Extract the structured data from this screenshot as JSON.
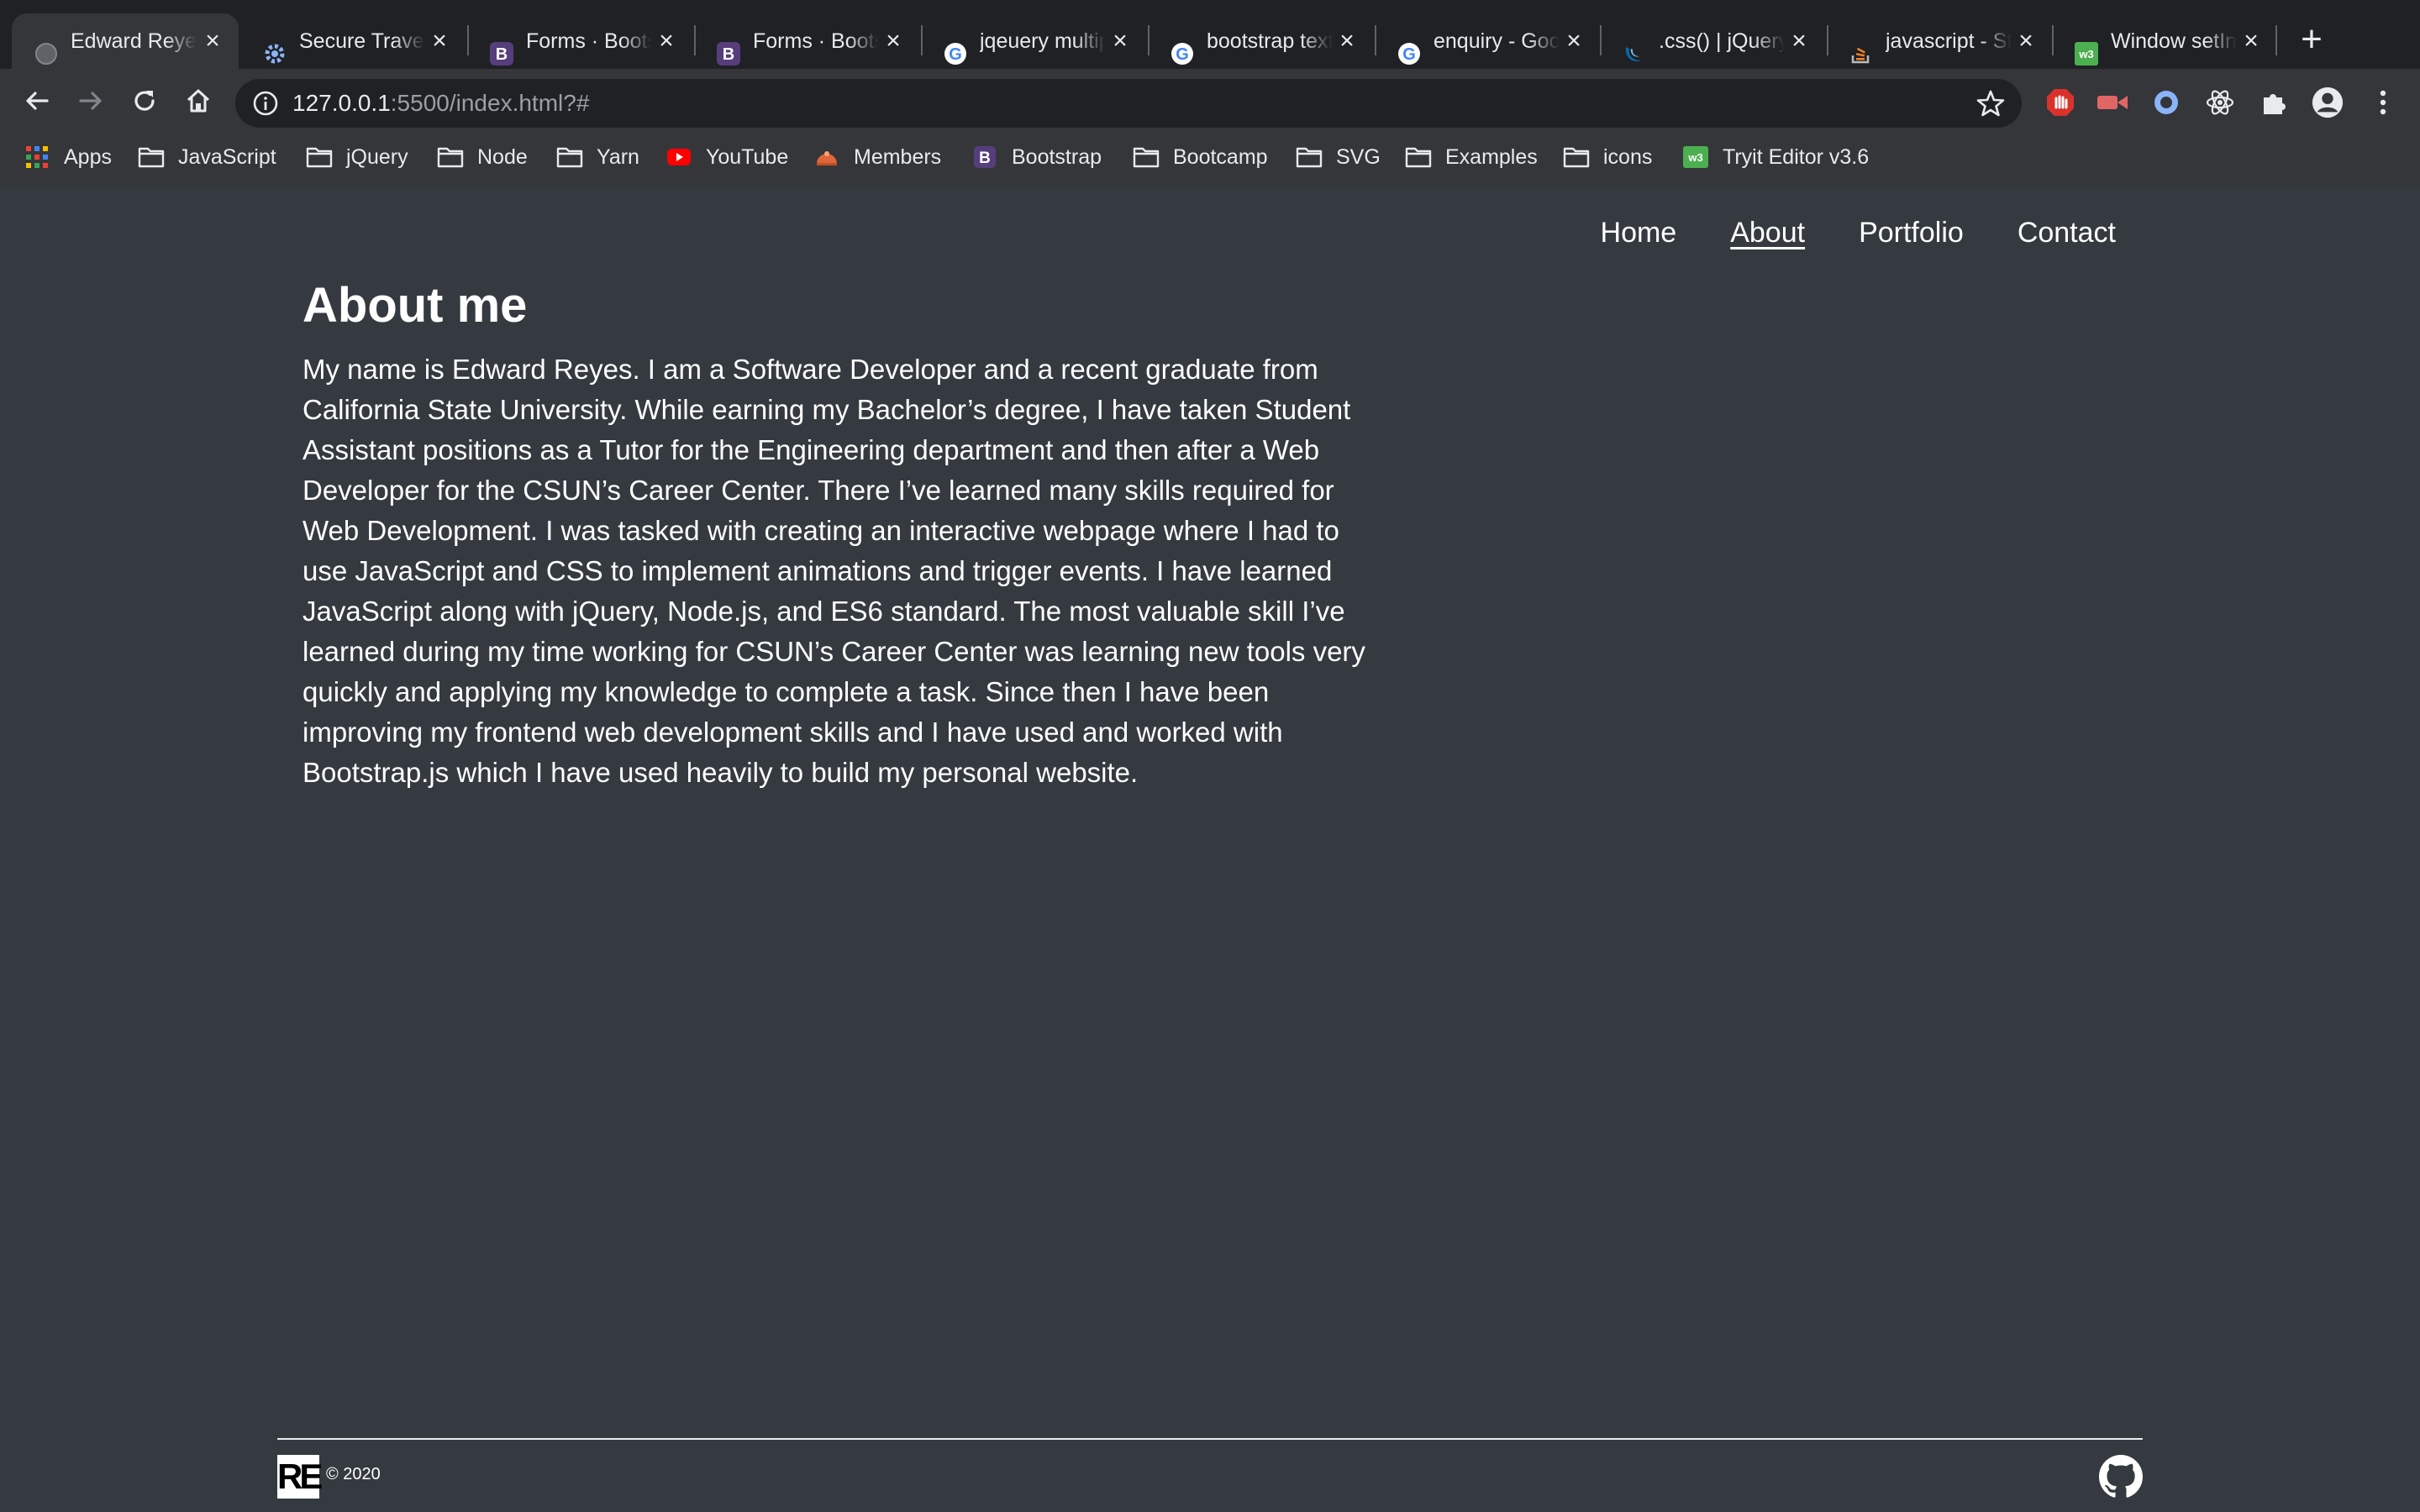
{
  "browser": {
    "tabs": [
      {
        "title": "Edward Reyes",
        "favicon": "globe-icon",
        "active": true
      },
      {
        "title": "Secure Travel",
        "favicon": "gear-icon"
      },
      {
        "title": "Forms · Bootstrap",
        "favicon": "bootstrap-icon"
      },
      {
        "title": "Forms · Bootstrap",
        "favicon": "bootstrap-icon"
      },
      {
        "title": "jqeuery multiple",
        "favicon": "google-icon"
      },
      {
        "title": "bootstrap text",
        "favicon": "google-icon"
      },
      {
        "title": "enquiry - Google",
        "favicon": "google-icon"
      },
      {
        "title": ".css() | jQuery",
        "favicon": "jquery-icon"
      },
      {
        "title": "javascript - Stack",
        "favicon": "stackoverflow-icon"
      },
      {
        "title": "Window setInterval",
        "favicon": "w3schools-icon"
      }
    ],
    "url": {
      "host": "127.0.0.1",
      "rest": ":5500/index.html?#"
    },
    "bookmarks": [
      {
        "label": "Apps",
        "icon": "apps-grid-icon"
      },
      {
        "label": "JavaScript",
        "icon": "folder-icon"
      },
      {
        "label": "jQuery",
        "icon": "folder-icon"
      },
      {
        "label": "Node",
        "icon": "folder-icon"
      },
      {
        "label": "Yarn",
        "icon": "folder-icon"
      },
      {
        "label": "YouTube",
        "icon": "youtube-icon"
      },
      {
        "label": "Members",
        "icon": "members-icon"
      },
      {
        "label": "Bootstrap",
        "icon": "bootstrap-icon"
      },
      {
        "label": "Bootcamp",
        "icon": "folder-icon"
      },
      {
        "label": "SVG",
        "icon": "folder-icon"
      },
      {
        "label": "Examples",
        "icon": "folder-icon"
      },
      {
        "label": "icons",
        "icon": "folder-icon"
      },
      {
        "label": "Tryit Editor v3.6",
        "icon": "w3schools-icon"
      }
    ],
    "colors": {
      "tabstrip": "#202124",
      "toolbar": "#35363a",
      "page_bg": "#343a40"
    }
  },
  "site": {
    "nav": [
      "Home",
      "About",
      "Portfolio",
      "Contact"
    ],
    "nav_current": "About",
    "heading": "About me",
    "body": "My name is Edward Reyes. I am a Software Developer and a recent graduate from California State University. While earning my Bachelor’s degree, I have taken Student Assistant positions as a Tutor for the Engineering department and then after a Web Developer for the CSUN’s Career Center. There I’ve learned many skills required for Web Development. I was tasked with creating an interactive webpage where I had to use JavaScript and CSS to implement animations and trigger events. I have learned JavaScript along with jQuery, Node.js, and ES6 standard. The most valuable skill I’ve learned during my time working for CSUN’s Career Center was learning new tools very quickly and applying my knowledge to complete a task. Since then I have been improving my frontend web development skills and I have used and worked with Bootstrap.js which I have used heavily to build my personal website.",
    "footer": {
      "logo_text": "RE",
      "copyright": "© 2020",
      "github_icon": "github-icon"
    }
  }
}
